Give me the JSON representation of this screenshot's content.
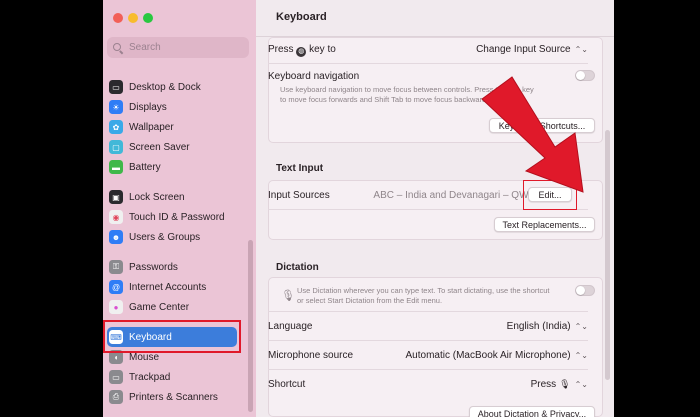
{
  "sidebar": {
    "search_placeholder": "Search",
    "items": [
      {
        "label": "Desktop & Dock",
        "icon": "desktop-dock-icon",
        "glyph": "▭",
        "color": "#2a2a2e"
      },
      {
        "label": "Displays",
        "icon": "displays-icon",
        "glyph": "☀",
        "color": "#2f7df6"
      },
      {
        "label": "Wallpaper",
        "icon": "wallpaper-icon",
        "glyph": "✿",
        "color": "#39a9e8"
      },
      {
        "label": "Screen Saver",
        "icon": "screen-saver-icon",
        "glyph": "▢",
        "color": "#41b8d8"
      },
      {
        "label": "Battery",
        "icon": "battery-icon",
        "glyph": "▬",
        "color": "#3fb84a"
      },
      {
        "label": "Lock Screen",
        "icon": "lock-screen-icon",
        "glyph": "▣",
        "color": "#2a2a2e"
      },
      {
        "label": "Touch ID & Password",
        "icon": "fingerprint-icon",
        "glyph": "◉",
        "color": "#f0f0f0"
      },
      {
        "label": "Users & Groups",
        "icon": "users-groups-icon",
        "glyph": "☻",
        "color": "#2f7df6"
      },
      {
        "label": "Passwords",
        "icon": "key-icon",
        "glyph": "⚿",
        "color": "#8a8a8e"
      },
      {
        "label": "Internet Accounts",
        "icon": "at-sign-icon",
        "glyph": "@",
        "color": "#2f7df6"
      },
      {
        "label": "Game Center",
        "icon": "game-center-icon",
        "glyph": "●",
        "color": "#f0f0f0"
      },
      {
        "label": "Keyboard",
        "icon": "keyboard-icon",
        "glyph": "⌨",
        "color": "#8a8a8e"
      },
      {
        "label": "Mouse",
        "icon": "mouse-icon",
        "glyph": "◖",
        "color": "#8a8a8e"
      },
      {
        "label": "Trackpad",
        "icon": "trackpad-icon",
        "glyph": "▭",
        "color": "#8a8a8e"
      },
      {
        "label": "Printers & Scanners",
        "icon": "printer-icon",
        "glyph": "⎙",
        "color": "#8a8a8e"
      }
    ]
  },
  "main": {
    "title": "Keyboard",
    "press_key_label_pre": "Press",
    "press_key_label_post": "key to",
    "press_key_value": "Change Input Source",
    "keyboard_nav_label": "Keyboard navigation",
    "keyboard_nav_desc_1": "Use keyboard navigation to move focus between controls. Press the Tab key",
    "keyboard_nav_desc_2": "to move focus forwards and Shift Tab to move focus backwards.",
    "shortcuts_button": "Keyboard Shortcuts...",
    "text_input_title": "Text Input",
    "input_sources_label": "Input Sources",
    "input_sources_value": "ABC – India and Devanagari – QWERTY",
    "edit_button": "Edit...",
    "text_replacements_button": "Text Replacements...",
    "dictation_title": "Dictation",
    "dictation_desc_1": "Use Dictation wherever you can type text. To start dictating, use the shortcut",
    "dictation_desc_2": "or select Start Dictation from the Edit menu.",
    "language_label": "Language",
    "language_value": "English (India)",
    "mic_label": "Microphone source",
    "mic_value": "Automatic (MacBook Air Microphone)",
    "shortcut_label": "Shortcut",
    "shortcut_value": "Press",
    "about_button": "About Dictation & Privacy..."
  },
  "colors": {
    "sidebar_bg": "#ebc5d6",
    "selection": "#3c7ddb",
    "annotation_red": "#e0192a"
  }
}
